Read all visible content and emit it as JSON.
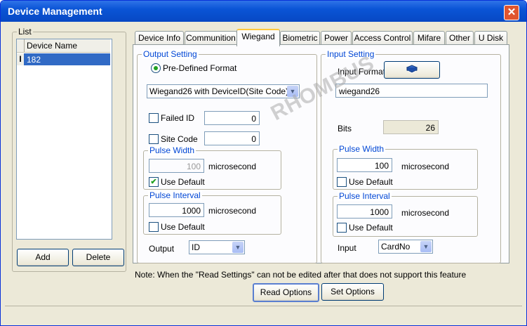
{
  "window": {
    "title": "Device Management",
    "close_glyph": "✕"
  },
  "list": {
    "label": "List",
    "column_header": "Device Name",
    "row_indicator": "I",
    "rows": [
      "182"
    ],
    "add_label": "Add",
    "delete_label": "Delete"
  },
  "tabs": [
    "Device Info",
    "Communition",
    "Wiegand",
    "Biometric",
    "Power",
    "Access Control",
    "Mifare",
    "Other",
    "U Disk"
  ],
  "active_tab": "Wiegand",
  "output": {
    "group_label": "Output Setting",
    "format_radio_label": "Pre-Defined Format",
    "format_value": "Wiegand26 with DeviceID(Site Code)",
    "failed_id_label": "Failed ID",
    "failed_id_value": "0",
    "site_code_label": "Site Code",
    "site_code_value": "0",
    "pulse_width_label": "Pulse Width",
    "pulse_width_value": "100",
    "pulse_width_unit": "microsecond",
    "pulse_width_default_label": "Use Default",
    "pulse_width_default_checked": true,
    "pulse_interval_label": "Pulse Interval",
    "pulse_interval_value": "1000",
    "pulse_interval_unit": "microsecond",
    "pulse_interval_default_label": "Use Default",
    "output_label": "Output",
    "output_value": "ID"
  },
  "input": {
    "group_label": "Input Setting",
    "format_label": "Input Format",
    "format_value": "wiegand26",
    "bits_label": "Bits",
    "bits_value": "26",
    "pulse_width_label": "Pulse Width",
    "pulse_width_value": "100",
    "pulse_width_unit": "microsecond",
    "pulse_width_default_label": "Use Default",
    "pulse_interval_label": "Pulse Interval",
    "pulse_interval_value": "1000",
    "pulse_interval_unit": "microsecond",
    "pulse_interval_default_label": "Use Default",
    "input_label": "Input",
    "input_value": "CardNo"
  },
  "note": "Note: When the \"Read Settings\" can not be edited after that does not support this feature",
  "buttons": {
    "read_options": "Read Options",
    "set_options": "Set Options"
  },
  "watermark": "RHOMBUS",
  "colors": {
    "accent": "#0a54d6",
    "group_label": "#0046d5",
    "selection": "#316ac5"
  }
}
